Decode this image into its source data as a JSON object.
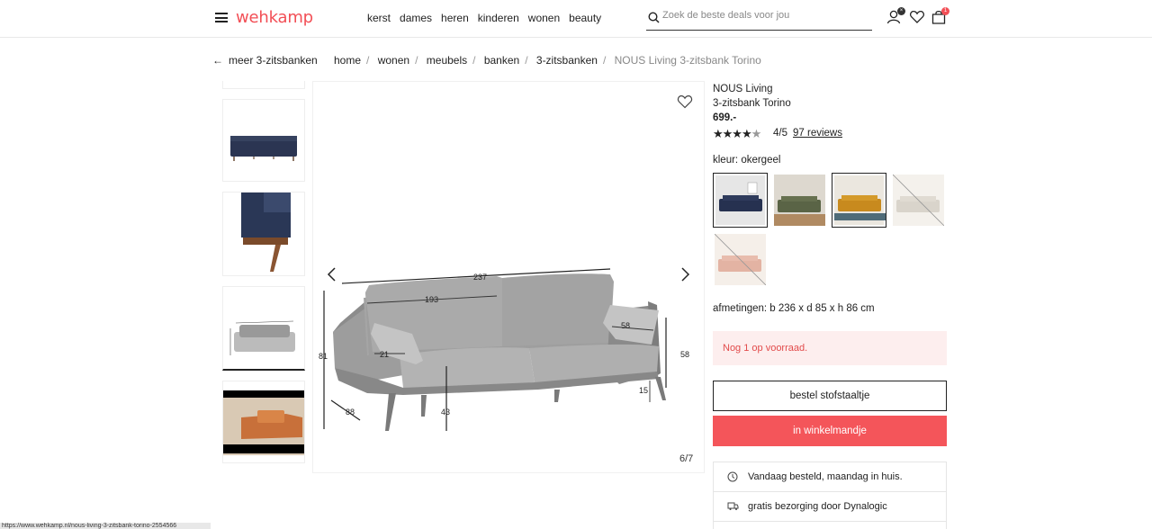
{
  "header": {
    "logo": "wehkamp",
    "nav": [
      "kerst",
      "dames",
      "heren",
      "kinderen",
      "wonen",
      "beauty"
    ],
    "search_placeholder": "Zoek de beste deals voor jou",
    "cart_count": "1",
    "user_badge": "×"
  },
  "breadcrumb": {
    "back_label": "meer 3-zitsbanken",
    "items": [
      "home",
      "wonen",
      "meubels",
      "banken",
      "3-zitsbanken"
    ],
    "current": "NOUS Living 3-zitsbank Torino"
  },
  "gallery": {
    "counter": "6/7",
    "dimensions": [
      "237",
      "193",
      "58",
      "81",
      "21",
      "58",
      "15",
      "88",
      "43"
    ]
  },
  "product": {
    "brand": "NOUS Living",
    "name": "3-zitsbank Torino",
    "price": "699.-",
    "rating_value": 4,
    "rating_max": 5,
    "rating": "4/5",
    "reviews": "97 reviews",
    "color_label": "kleur: okergeel",
    "dimensions": "afmetingen: b 236 x d 85 x h 86 cm",
    "stock": "Nog 1 op voorraad.",
    "btn_sample": "bestel stofstaaltje",
    "btn_cart": "in winkelmandje",
    "usps": [
      "Vandaag besteld, maandag in huis.",
      "gratis bezorging door Dynalogic"
    ]
  },
  "colors": {
    "brand": "#f24f56",
    "stock_bg": "#fdeeee"
  },
  "statusbar": "https://www.wehkamp.nl/nous-living-3-zitsbank-torino-2554566"
}
